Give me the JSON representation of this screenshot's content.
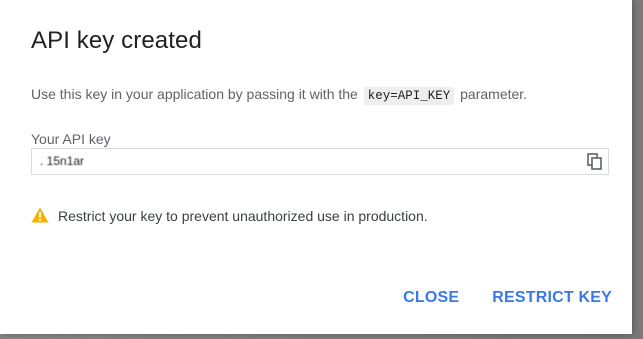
{
  "dialog": {
    "title": "API key created",
    "description_before": "Use this key in your application by passing it with the",
    "code_param": "key=API_KEY",
    "description_after": "parameter.",
    "field_label": "Your API key",
    "api_key_value": ".                                           15n1ar",
    "warning_text": "Restrict your key to prevent unauthorized use in production.",
    "close_label": "CLOSE",
    "restrict_label": "RESTRICT KEY"
  },
  "icons": {
    "copy": "copy-icon",
    "warning": "warning-icon"
  },
  "colors": {
    "accent": "#3b78e7",
    "warning": "#f4b400"
  }
}
